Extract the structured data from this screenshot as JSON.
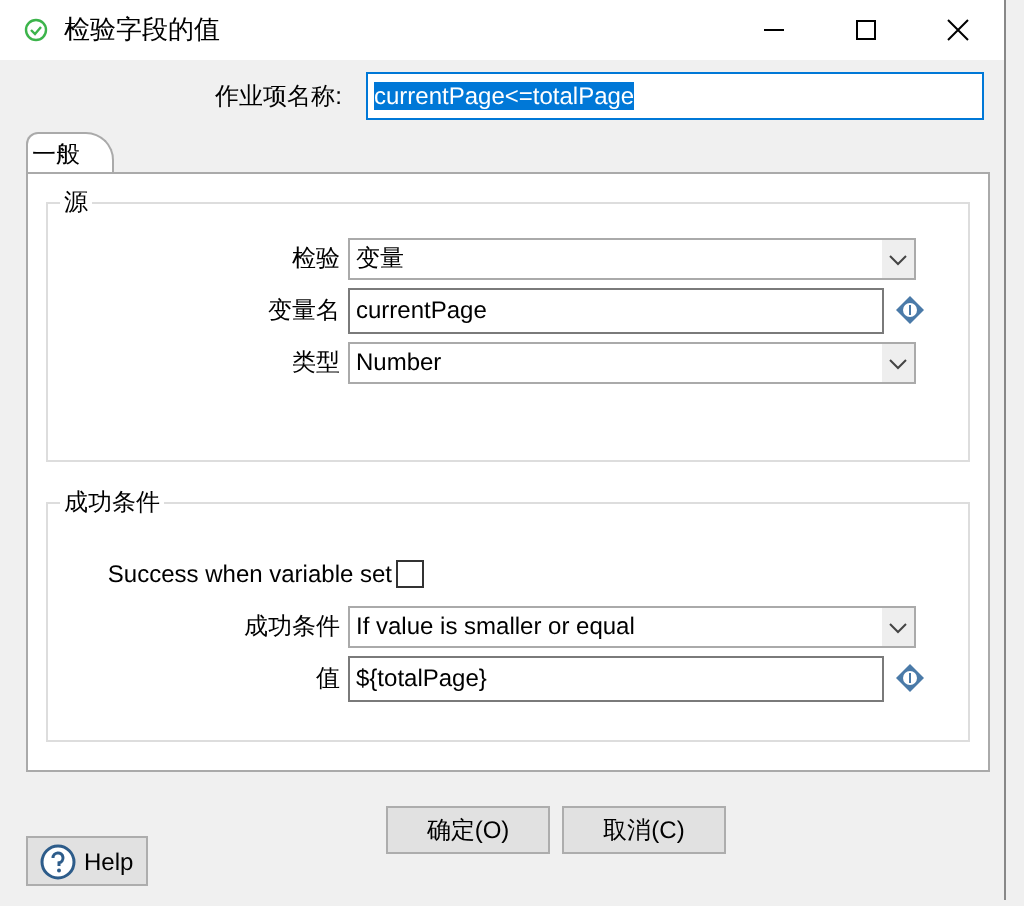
{
  "window": {
    "title": "检验字段的值"
  },
  "job_name": {
    "label": "作业项名称:",
    "value": "currentPage<=totalPage"
  },
  "tabs": [
    {
      "label": "一般",
      "selected": true
    }
  ],
  "groups": [
    {
      "title": "源",
      "rows": [
        {
          "kind": "select",
          "label": "检验",
          "value": "变量"
        },
        {
          "kind": "text",
          "label": "变量名",
          "value": "currentPage"
        },
        {
          "kind": "select",
          "label": "类型",
          "value": "Number"
        }
      ]
    },
    {
      "title": "成功条件",
      "rows": [
        {
          "kind": "checkbox",
          "label": "Success when variable set",
          "checked": false
        },
        {
          "kind": "select",
          "label": "成功条件",
          "value": "If value is smaller or equal"
        },
        {
          "kind": "text",
          "label": "值",
          "value": "${totalPage}"
        }
      ]
    }
  ],
  "buttons": [
    "确定(O)",
    "取消(C)"
  ],
  "help": "Help"
}
